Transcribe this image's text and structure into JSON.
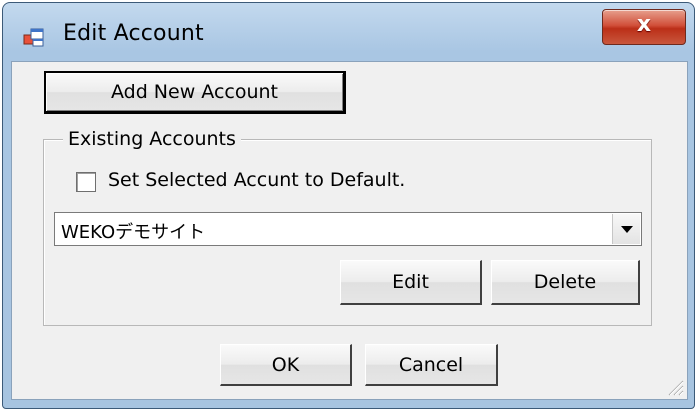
{
  "window": {
    "title": "Edit Account",
    "close_label": "x"
  },
  "buttons": {
    "add_new_account": "Add New Account",
    "edit": "Edit",
    "delete": "Delete",
    "ok": "OK",
    "cancel": "Cancel"
  },
  "existing_accounts": {
    "group_label": "Existing Accounts",
    "checkbox_label": "Set Selected Accunt to Default.",
    "checkbox_checked": false,
    "selected_account": "WEKOデモサイト"
  },
  "icons": {
    "app": "app-window-icon",
    "close": "close-icon",
    "dropdown": "chevron-down-icon",
    "resize": "resize-grip-icon"
  },
  "colors": {
    "titlebar": "#a9c6e3",
    "close_button": "#c9462e",
    "client_background": "#f0f0f0"
  }
}
